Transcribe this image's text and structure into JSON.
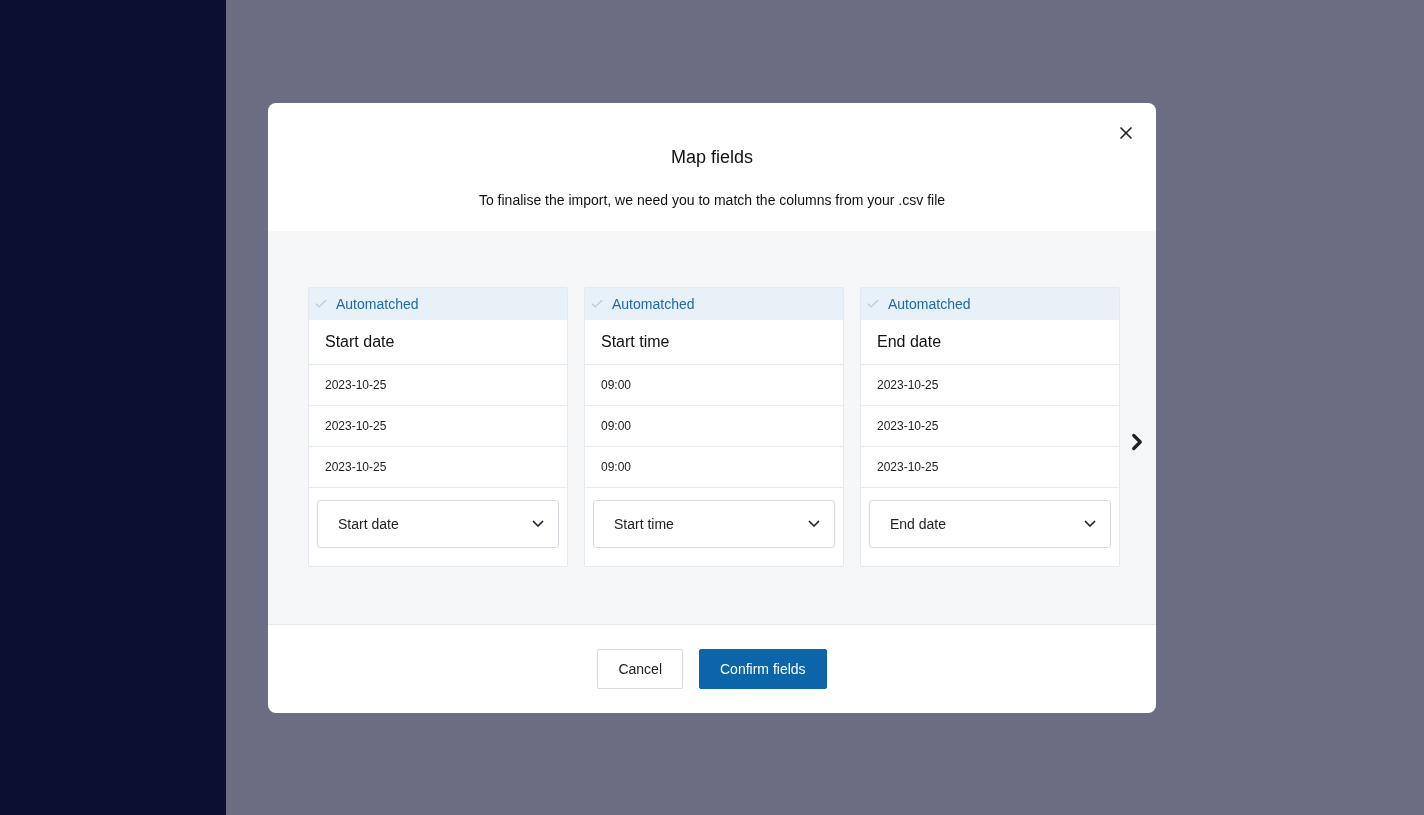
{
  "dialog": {
    "title": "Map fields",
    "description": "To finalise the import, we need you to match the columns from your .csv file",
    "columns": [
      {
        "status": "Automatched",
        "header": "Start date",
        "samples": [
          "2023-10-25",
          "2023-10-25",
          "2023-10-25"
        ],
        "mapping": "Start date"
      },
      {
        "status": "Automatched",
        "header": "Start time",
        "samples": [
          "09:00",
          "09:00",
          "09:00"
        ],
        "mapping": "Start time"
      },
      {
        "status": "Automatched",
        "header": "End date",
        "samples": [
          "2023-10-25",
          "2023-10-25",
          "2023-10-25"
        ],
        "mapping": "End date"
      }
    ],
    "buttons": [
      {
        "label": "Cancel",
        "kind": "secondary"
      },
      {
        "label": "Confirm fields",
        "kind": "primary"
      }
    ]
  }
}
